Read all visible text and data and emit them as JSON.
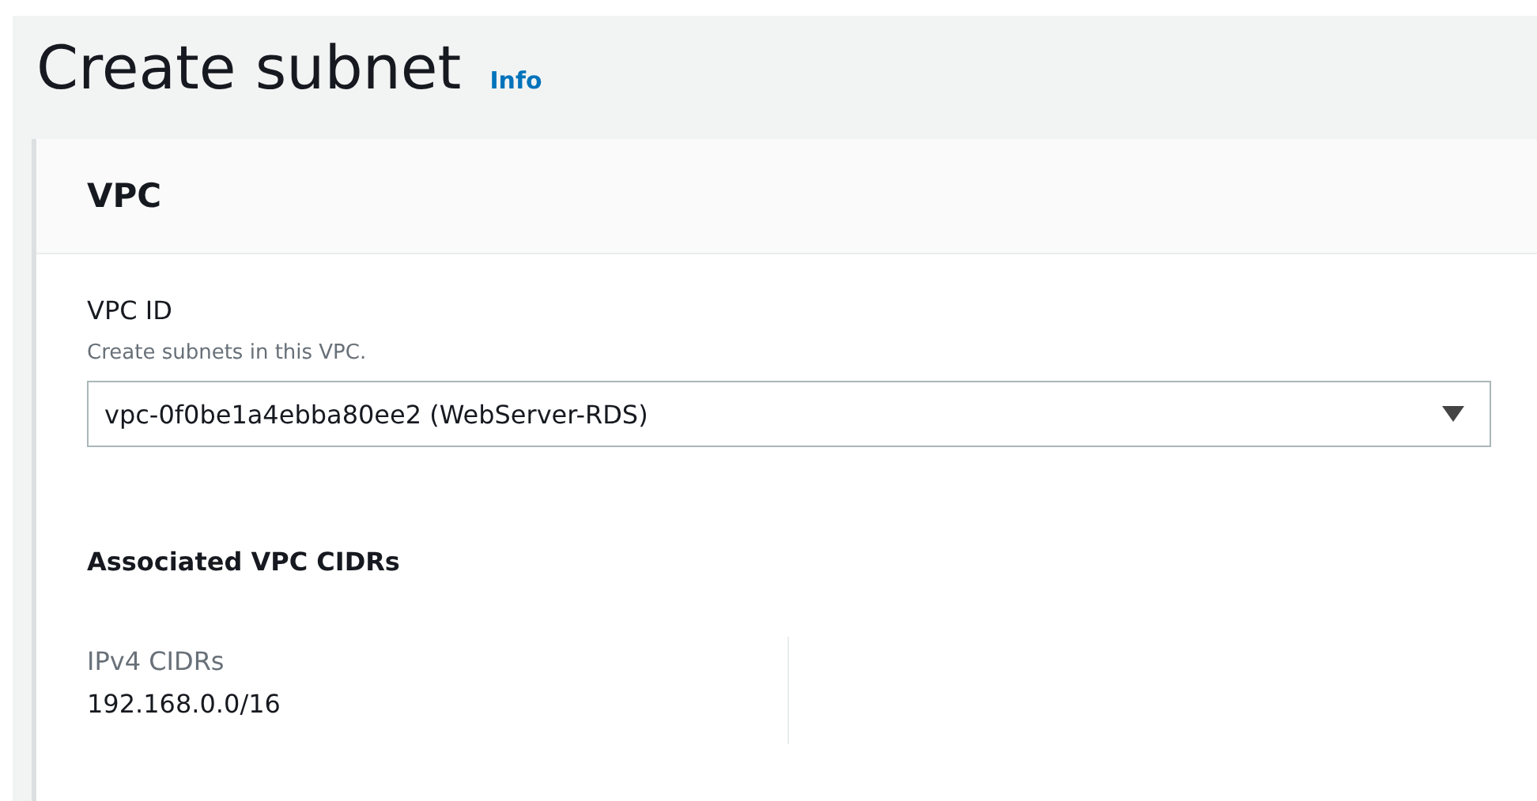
{
  "page": {
    "title": "Create subnet",
    "info_link": "Info"
  },
  "card": {
    "title": "VPC",
    "vpc_field": {
      "label": "VPC ID",
      "description": "Create subnets in this VPC.",
      "value": "vpc-0f0be1a4ebba80ee2 (WebServer-RDS)"
    },
    "cidrs": {
      "heading": "Associated VPC CIDRs",
      "columns": [
        {
          "label": "IPv4 CIDRs",
          "value": "192.168.0.0/16"
        }
      ]
    }
  }
}
